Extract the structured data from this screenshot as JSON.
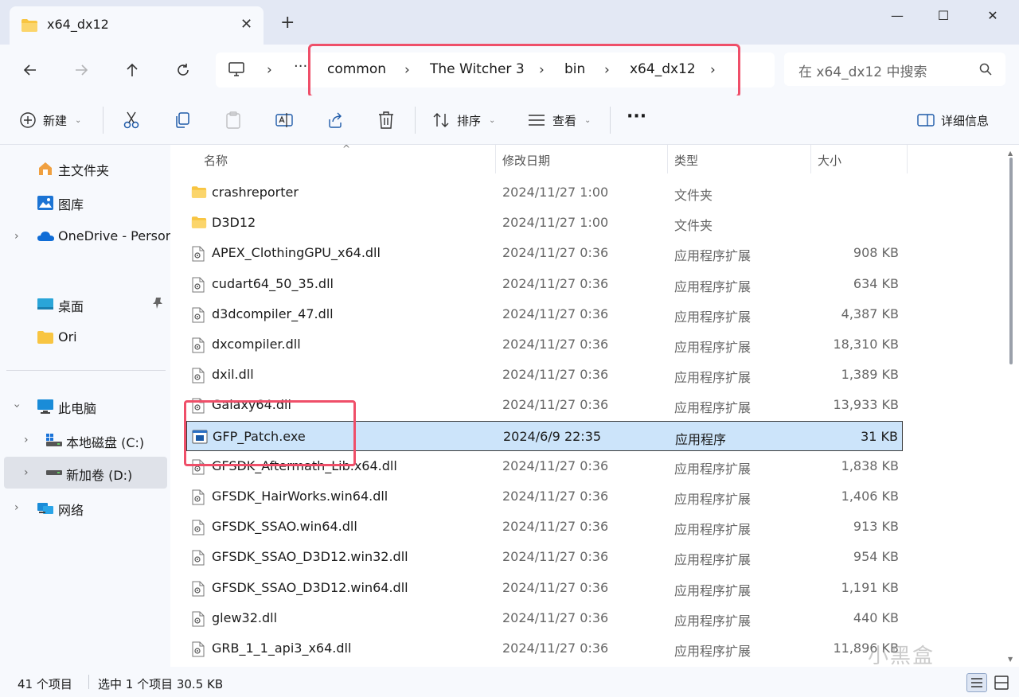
{
  "tab": {
    "title": "x64_dx12",
    "close": "✕",
    "new_tab": "+"
  },
  "window": {
    "minimize": "—",
    "maximize": "☐",
    "close": "✕"
  },
  "address": {
    "more": "···",
    "crumbs": [
      "common",
      "The Witcher 3",
      "bin",
      "x64_dx12"
    ]
  },
  "search": {
    "placeholder": "在 x64_dx12 中搜索"
  },
  "toolbar": {
    "new_label": "新建",
    "sort_label": "排序",
    "view_label": "查看",
    "more_label": "···",
    "details_label": "详细信息"
  },
  "nav": {
    "home": "主文件夹",
    "gallery": "图库",
    "onedrive": "OneDrive - Persor",
    "desktop": "桌面",
    "ori": "Ori",
    "this_pc": "此电脑",
    "drive_c": "本地磁盘 (C:)",
    "drive_d": "新加卷 (D:)",
    "network": "网络"
  },
  "columns": {
    "name": "名称",
    "date": "修改日期",
    "type": "类型",
    "size": "大小"
  },
  "files": [
    {
      "name": "crashreporter",
      "date": "2024/11/27 1:00",
      "type": "文件夹",
      "size": "",
      "kind": "folder"
    },
    {
      "name": "D3D12",
      "date": "2024/11/27 1:00",
      "type": "文件夹",
      "size": "",
      "kind": "folder"
    },
    {
      "name": "APEX_ClothingGPU_x64.dll",
      "date": "2024/11/27 0:36",
      "type": "应用程序扩展",
      "size": "908 KB",
      "kind": "dll"
    },
    {
      "name": "cudart64_50_35.dll",
      "date": "2024/11/27 0:36",
      "type": "应用程序扩展",
      "size": "634 KB",
      "kind": "dll"
    },
    {
      "name": "d3dcompiler_47.dll",
      "date": "2024/11/27 0:36",
      "type": "应用程序扩展",
      "size": "4,387 KB",
      "kind": "dll"
    },
    {
      "name": "dxcompiler.dll",
      "date": "2024/11/27 0:36",
      "type": "应用程序扩展",
      "size": "18,310 KB",
      "kind": "dll"
    },
    {
      "name": "dxil.dll",
      "date": "2024/11/27 0:36",
      "type": "应用程序扩展",
      "size": "1,389 KB",
      "kind": "dll"
    },
    {
      "name": "Galaxy64.dll",
      "date": "2024/11/27 0:36",
      "type": "应用程序扩展",
      "size": "13,933 KB",
      "kind": "dll"
    },
    {
      "name": "GFP_Patch.exe",
      "date": "2024/6/9 22:35",
      "type": "应用程序",
      "size": "31 KB",
      "kind": "exe"
    },
    {
      "name": "GFSDK_Aftermath_Lib.x64.dll",
      "date": "2024/11/27 0:36",
      "type": "应用程序扩展",
      "size": "1,838 KB",
      "kind": "dll"
    },
    {
      "name": "GFSDK_HairWorks.win64.dll",
      "date": "2024/11/27 0:36",
      "type": "应用程序扩展",
      "size": "1,406 KB",
      "kind": "dll"
    },
    {
      "name": "GFSDK_SSAO.win64.dll",
      "date": "2024/11/27 0:36",
      "type": "应用程序扩展",
      "size": "913 KB",
      "kind": "dll"
    },
    {
      "name": "GFSDK_SSAO_D3D12.win32.dll",
      "date": "2024/11/27 0:36",
      "type": "应用程序扩展",
      "size": "954 KB",
      "kind": "dll"
    },
    {
      "name": "GFSDK_SSAO_D3D12.win64.dll",
      "date": "2024/11/27 0:36",
      "type": "应用程序扩展",
      "size": "1,191 KB",
      "kind": "dll"
    },
    {
      "name": "glew32.dll",
      "date": "2024/11/27 0:36",
      "type": "应用程序扩展",
      "size": "440 KB",
      "kind": "dll"
    },
    {
      "name": "GRB_1_1_api3_x64.dll",
      "date": "2024/11/27 0:36",
      "type": "应用程序扩展",
      "size": "11,896 KB",
      "kind": "dll"
    }
  ],
  "selected_file": "GFP_Patch.exe",
  "status": {
    "count": "41 个项目",
    "selection": "选中 1 个项目 30.5 KB"
  },
  "watermark": "小黑盒",
  "colors": {
    "highlight": "#ef4f69",
    "selection": "#cce4fa",
    "accent": "#0067c0",
    "folder": "#f8c542"
  },
  "icons": [
    "folder-icon",
    "dll-file-icon",
    "exe-file-icon",
    "home-icon",
    "gallery-icon",
    "onedrive-icon",
    "desktop-icon",
    "pc-icon",
    "drive-icon",
    "network-icon",
    "search-icon",
    "pin-icon"
  ]
}
